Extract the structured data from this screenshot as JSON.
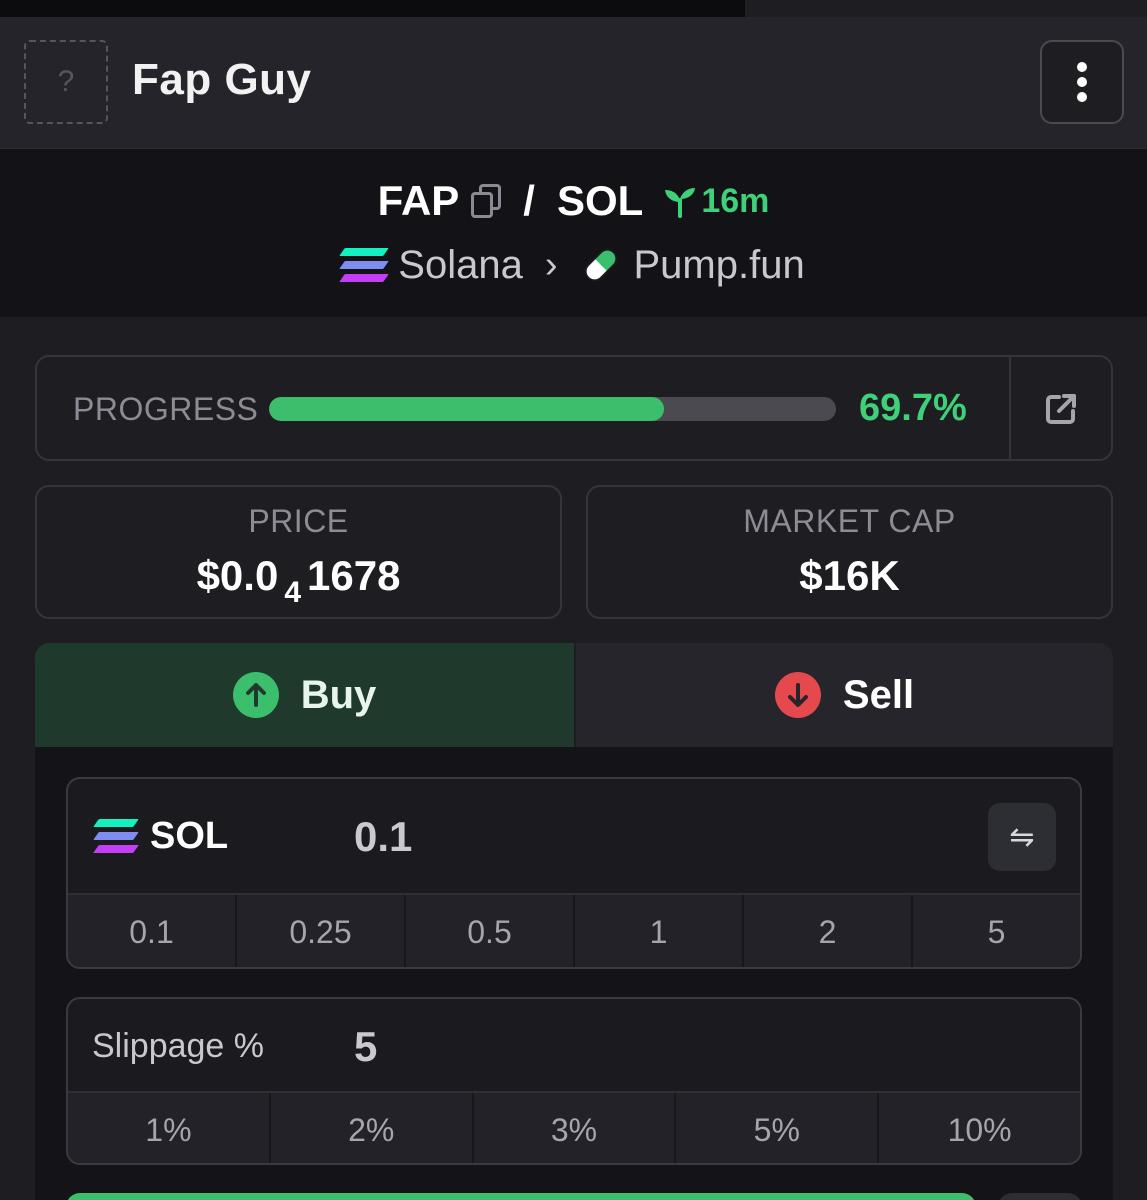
{
  "header": {
    "token_image_placeholder": "?",
    "token_name": "Fap Guy",
    "menu_icon": "more-vertical-icon"
  },
  "pair": {
    "base": "FAP",
    "separator": "/",
    "quote": "SOL",
    "age": "16m",
    "chain": "Solana",
    "dex": "Pump.fun"
  },
  "progress": {
    "label": "PROGRESS",
    "value_text": "69.7%",
    "fraction": 0.697
  },
  "stats": {
    "price_label": "PRICE",
    "price_prefix": "$0.0",
    "price_zeros": "4",
    "price_digits": "1678",
    "mcap_label": "MARKET CAP",
    "mcap_value": "$16K"
  },
  "trade": {
    "buy_label": "Buy",
    "sell_label": "Sell",
    "currency": "SOL",
    "amount": "0.1",
    "amount_presets": [
      "0.1",
      "0.25",
      "0.5",
      "1",
      "2",
      "5"
    ],
    "slippage_label": "Slippage %",
    "slippage_value": "5",
    "slippage_presets": [
      "1%",
      "2%",
      "3%",
      "5%",
      "10%"
    ]
  },
  "colors": {
    "accent_green": "#3fd17a",
    "sell_red": "#e5484d",
    "buy_tab_bg": "#1f3a2c"
  }
}
